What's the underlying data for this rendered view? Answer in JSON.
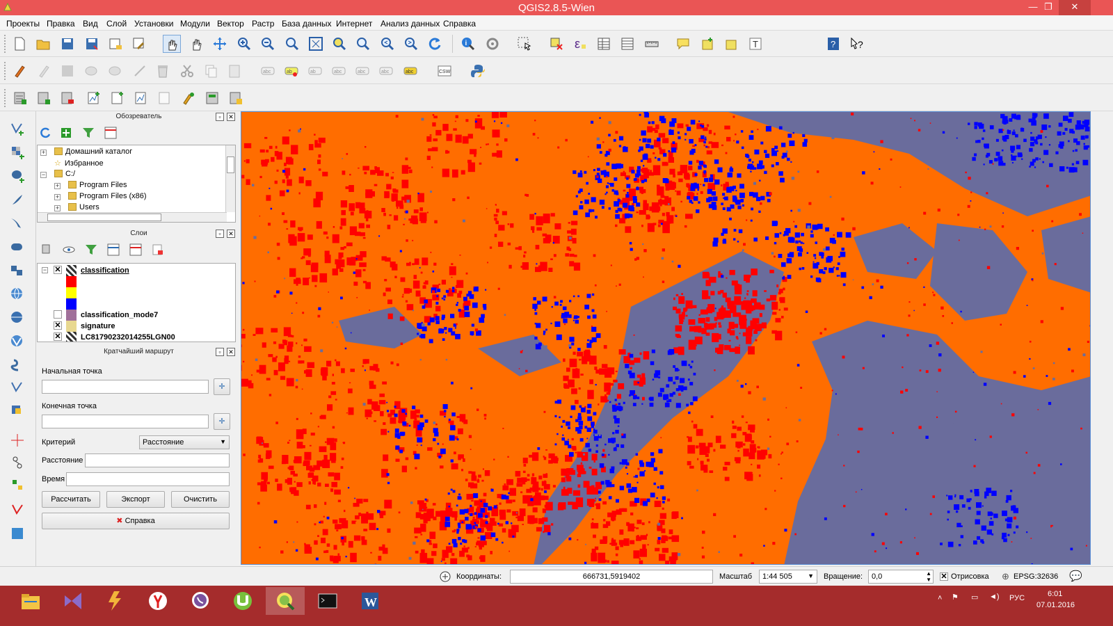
{
  "window": {
    "title": "QGIS2.8.5-Wien",
    "minimize": "—",
    "maximize": "❐",
    "close": "✕"
  },
  "menu": [
    "Проекты",
    "Правка",
    "Вид",
    "Слой",
    "Установки",
    "Модули",
    "Вектор",
    "Растр",
    "База данных",
    "Интернет",
    "Анализ данных",
    "Справка"
  ],
  "browser": {
    "title": "Обозреватель",
    "items": [
      {
        "label": "Домашний каталог",
        "icon": "folder-icon",
        "expand": "+"
      },
      {
        "label": "Избранное",
        "icon": "star-icon",
        "expand": ""
      },
      {
        "label": "C:/",
        "icon": "folder-icon",
        "expand": "−"
      },
      {
        "label": "Program Files",
        "icon": "folder-icon",
        "expand": "+"
      },
      {
        "label": "Program Files (x86)",
        "icon": "folder-icon",
        "expand": "+"
      },
      {
        "label": "Users",
        "icon": "folder-icon",
        "expand": "+"
      }
    ]
  },
  "layers": {
    "title": "Слои",
    "items": [
      {
        "label": "classification",
        "checked": true,
        "expand": "−"
      },
      {
        "label": "classification_mode7",
        "checked": false,
        "expand": ""
      },
      {
        "label": "signature",
        "checked": true,
        "expand": ""
      },
      {
        "label": "LC81790232014255LGN00",
        "checked": true,
        "expand": ""
      }
    ],
    "legend_colors": [
      "#ff0000",
      "#ffff00",
      "#0000ff"
    ],
    "mode7_color": "#a0709a",
    "signature_color": "#e8d890"
  },
  "route": {
    "title": "Кратчайший маршрут",
    "start_label": "Начальная точка",
    "start_value": "",
    "end_label": "Конечная точка",
    "end_value": "",
    "criterion_label": "Критерий",
    "criterion_value": "Расстояние",
    "distance_label": "Расстояние",
    "distance_value": "",
    "time_label": "Время",
    "time_value": "",
    "calc_button": "Рассчитать",
    "export_button": "Экспорт",
    "clear_button": "Очистить",
    "help_button": "Справка"
  },
  "map_colors": {
    "orange": "#ff6d00",
    "red": "#ff0000",
    "blue": "#0000ff",
    "gray": "#6a6c9c"
  },
  "status": {
    "coord_label": "Координаты:",
    "coord_value": "666731,5919402",
    "scale_label": "Масштаб",
    "scale_value": "1:44 505",
    "rotation_label": "Вращение:",
    "rotation_value": "0,0",
    "render_label": "Отрисовка",
    "epsg": "EPSG:32636"
  },
  "taskbar": {
    "apps": [
      "file-explorer-icon",
      "visual-studio-icon",
      "winamp-icon",
      "yandex-browser-icon",
      "viber-icon",
      "utorrent-icon",
      "qgis-icon",
      "cmd-icon",
      "word-icon"
    ],
    "lang": "РУС",
    "time": "6:01",
    "date": "07.01.2016"
  }
}
